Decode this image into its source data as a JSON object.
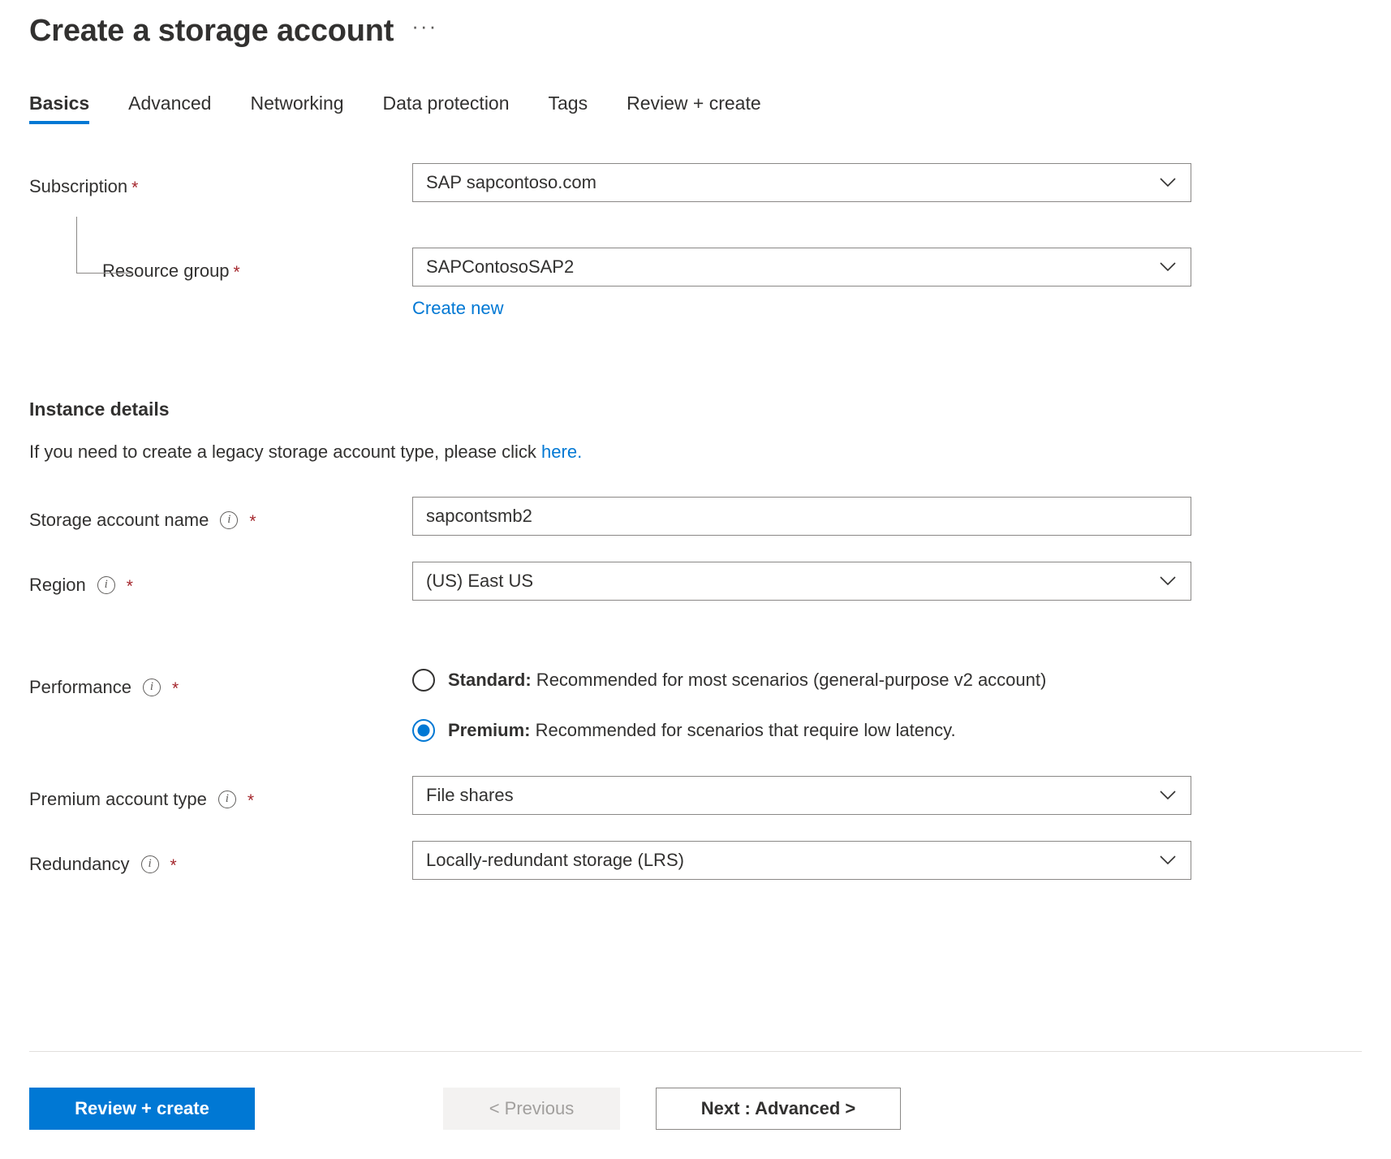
{
  "header": {
    "title": "Create a storage account",
    "more_label": "···"
  },
  "tabs": [
    {
      "label": "Basics",
      "active": true
    },
    {
      "label": "Advanced",
      "active": false
    },
    {
      "label": "Networking",
      "active": false
    },
    {
      "label": "Data protection",
      "active": false
    },
    {
      "label": "Tags",
      "active": false
    },
    {
      "label": "Review + create",
      "active": false
    }
  ],
  "form": {
    "subscription": {
      "label": "Subscription",
      "required_marker": "*",
      "value": "SAP sapcontoso.com"
    },
    "resource_group": {
      "label": "Resource group",
      "required_marker": "*",
      "value": "SAPContosoSAP2",
      "create_new_label": "Create new"
    }
  },
  "instance_details": {
    "section_title": "Instance details",
    "note_prefix": "If you need to create a legacy storage account type, please click ",
    "note_link": "here.",
    "storage_account_name": {
      "label": "Storage account name",
      "required_marker": "*",
      "value": "sapcontsmb2"
    },
    "region": {
      "label": "Region",
      "required_marker": "*",
      "value": "(US) East US"
    },
    "performance": {
      "label": "Performance",
      "required_marker": "*",
      "options": [
        {
          "name": "Standard",
          "bold_text": "Standard:",
          "description": " Recommended for most scenarios (general-purpose v2 account)",
          "selected": false
        },
        {
          "name": "Premium",
          "bold_text": "Premium:",
          "description": " Recommended for scenarios that require low latency.",
          "selected": true
        }
      ]
    },
    "premium_account_type": {
      "label": "Premium account type",
      "required_marker": "*",
      "value": "File shares"
    },
    "redundancy": {
      "label": "Redundancy",
      "required_marker": "*",
      "value": "Locally-redundant storage (LRS)"
    }
  },
  "footer": {
    "review_create_label": "Review + create",
    "previous_label": "< Previous",
    "next_label": "Next : Advanced >"
  },
  "colors": {
    "accent": "#0078d4",
    "required_marker": "#a4262c",
    "border": "#8a8886",
    "text": "#323130",
    "disabled_bg": "#f3f2f1",
    "disabled_text": "#a19f9d"
  }
}
